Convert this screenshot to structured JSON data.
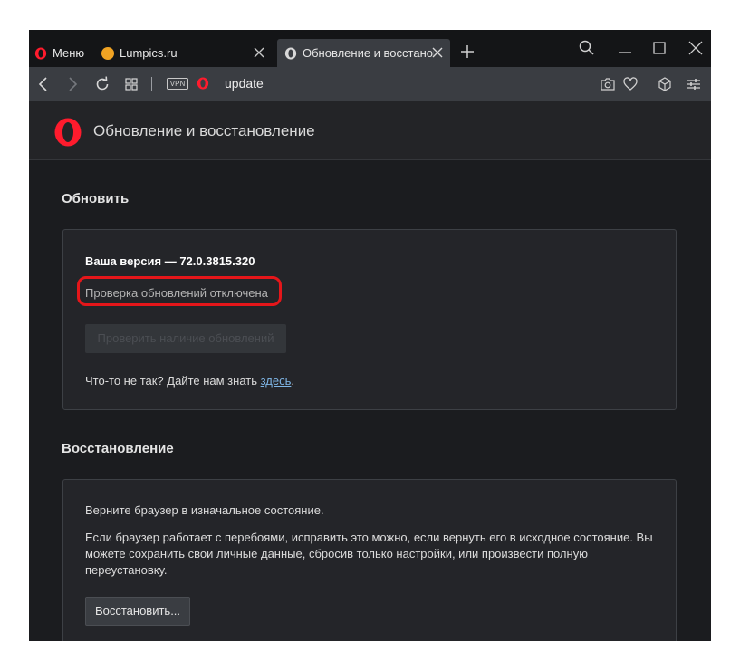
{
  "tabs": {
    "menu_label": "Меню",
    "items": [
      {
        "label": "Lumpics.ru"
      },
      {
        "label": "Обновление и восстановление"
      }
    ]
  },
  "addressbar": {
    "vpn_badge": "VPN",
    "url": "update"
  },
  "header": {
    "title": "Обновление и восстановление"
  },
  "update": {
    "section_title": "Обновить",
    "version_label": "Ваша версия — 72.0.3815.320",
    "status_text": "Проверка обновлений отключена",
    "check_button": "Проверить наличие обновлений",
    "feedback_prefix": "Что-то не так? Дайте нам знать ",
    "feedback_link": "здесь",
    "feedback_suffix": "."
  },
  "recovery": {
    "section_title": "Восстановление",
    "intro": "Верните браузер в изначальное состояние.",
    "description": "Если браузер работает с перебоями, исправить это можно, если вернуть его в исходное состояние. Вы можете сохранить свои личные данные, сбросив только настройки, или произвести полную переустановку.",
    "restore_button": "Восстановить..."
  },
  "colors": {
    "accent_red": "#e5161a",
    "opera_red": "#ff1b2d",
    "link": "#7fb6e6",
    "background": "#1b1c1f"
  },
  "icons": [
    "opera-icon",
    "lumpics-icon",
    "close-icon",
    "plus-icon",
    "search-icon",
    "minimize-icon",
    "maximize-icon",
    "window-close-icon",
    "back-icon",
    "forward-icon",
    "reload-icon",
    "tabs-grid-icon",
    "camera-icon",
    "heart-icon",
    "cube-icon",
    "menu-sliders-icon"
  ]
}
